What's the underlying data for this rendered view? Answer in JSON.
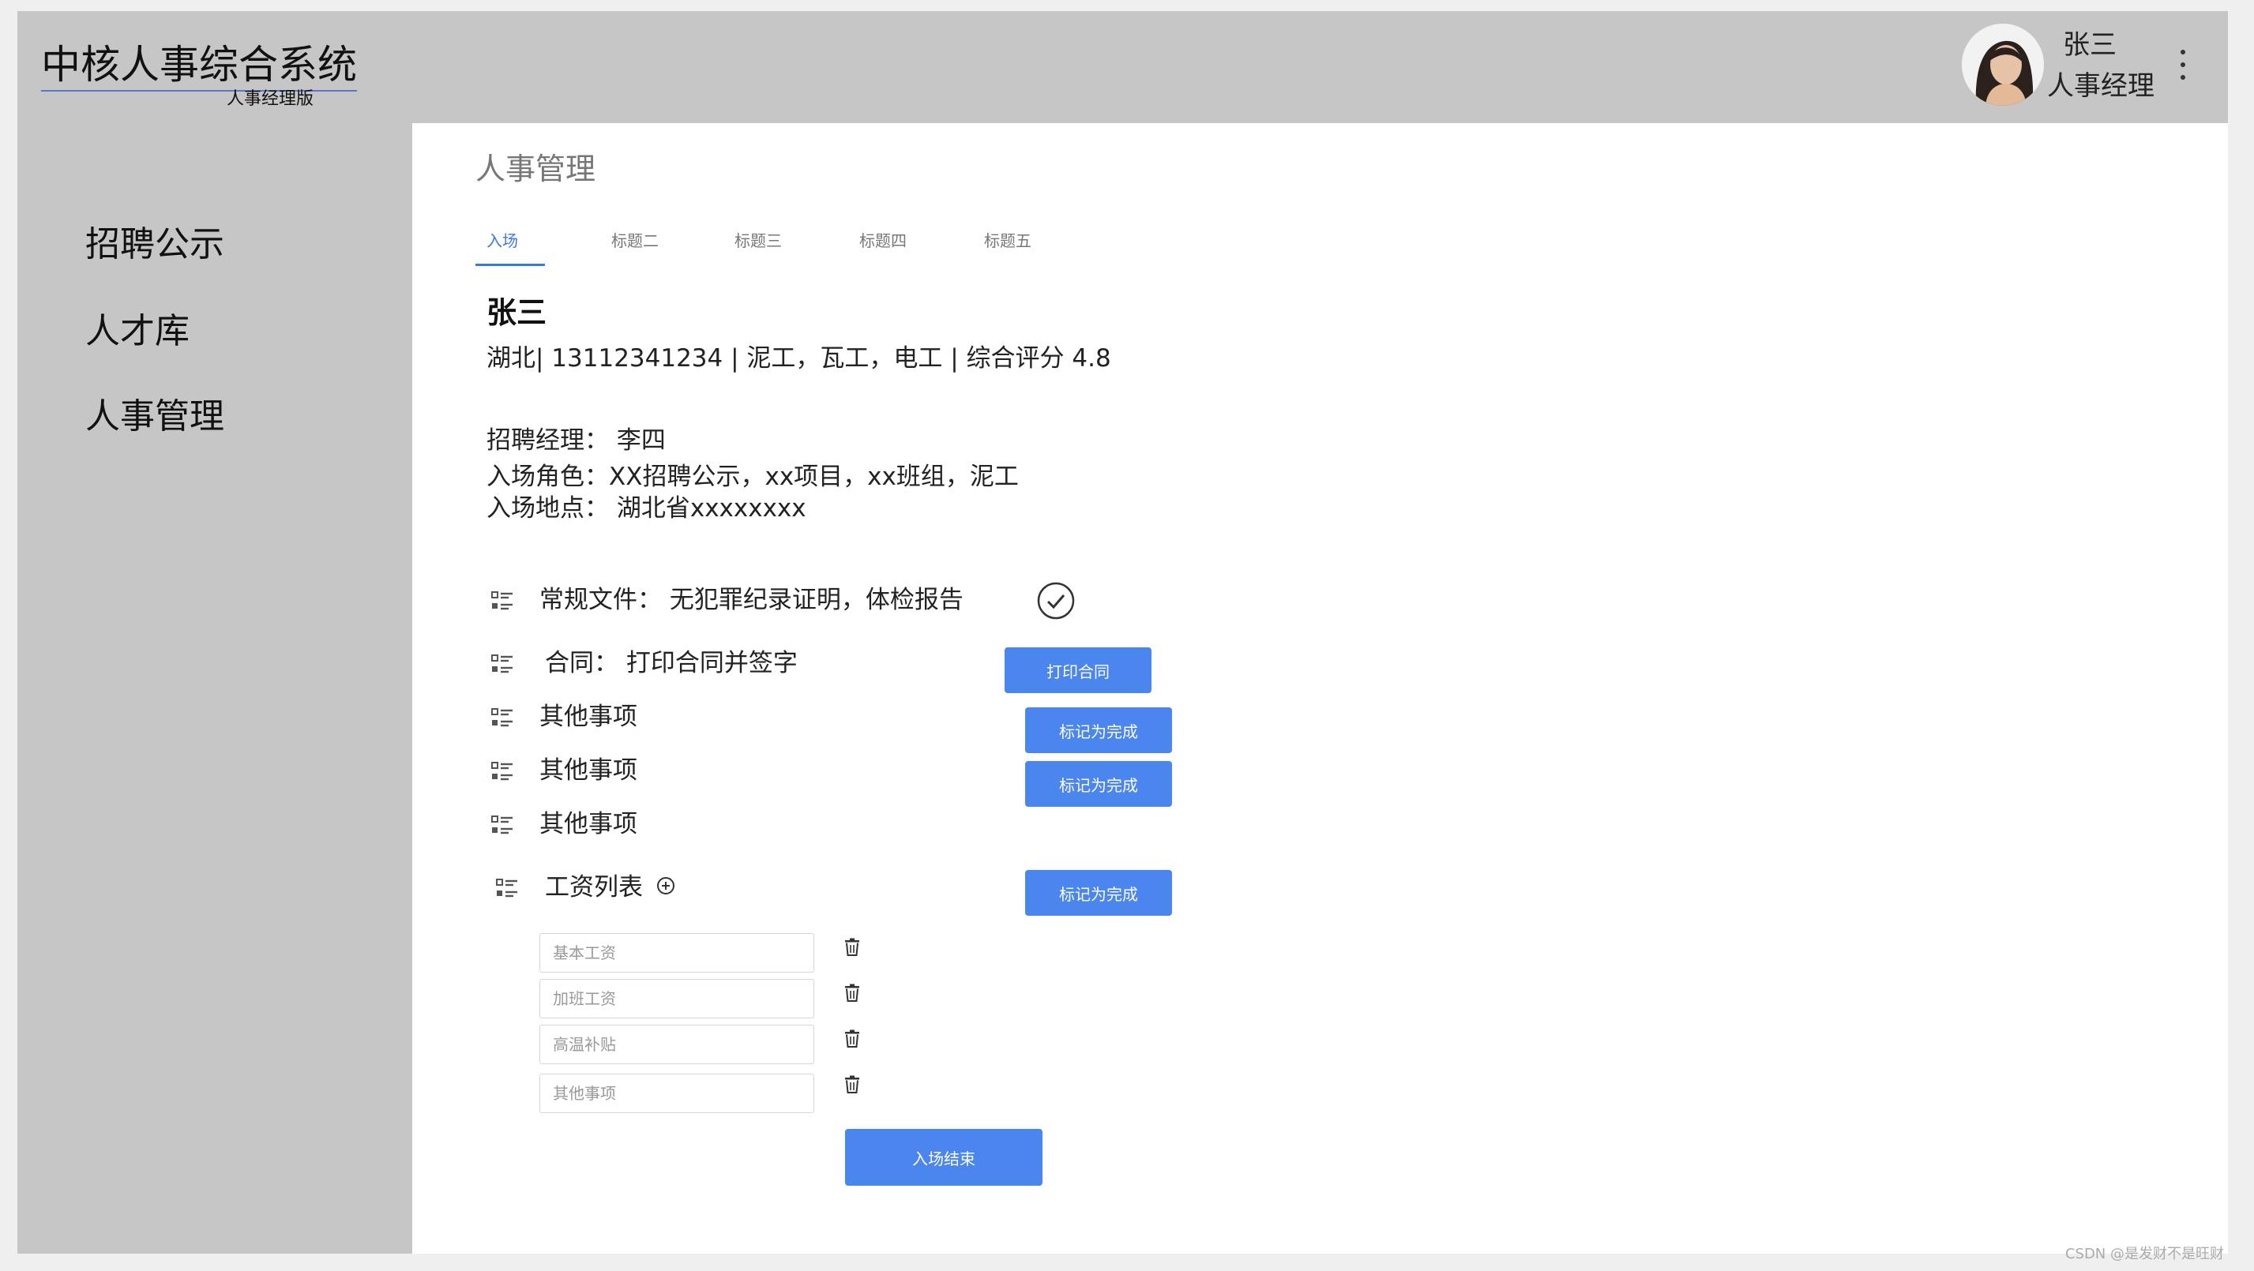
{
  "header": {
    "app_title": "中核人事综合系统",
    "app_subtitle": "人事经理版",
    "user_name": "张三",
    "user_role": "人事经理"
  },
  "sidebar": {
    "items": [
      {
        "label": "招聘公示"
      },
      {
        "label": "人才库"
      },
      {
        "label": "人事管理"
      }
    ]
  },
  "main": {
    "page_title": "人事管理",
    "tabs": [
      {
        "label": "入场",
        "active": true
      },
      {
        "label": "标题二"
      },
      {
        "label": "标题三"
      },
      {
        "label": "标题四"
      },
      {
        "label": "标题五"
      }
    ],
    "person": {
      "name": "张三",
      "summary": "湖北| 13112341234 | 泥工，瓦工，电工 | 综合评分 4.8",
      "manager": "招聘经理： 李四",
      "role": "入场角色：XX招聘公示，xx项目，xx班组，泥工",
      "location": "入场地点： 湖北省xxxxxxxx"
    },
    "tasks": [
      {
        "label": "常规文件： 无犯罪纪录证明，体检报告",
        "status_icon": "check-circle-icon"
      },
      {
        "label": "合同： 打印合同并签字",
        "button": "打印合同"
      },
      {
        "label": "其他事项",
        "button": "标记为完成"
      },
      {
        "label": "其他事项",
        "button": "标记为完成"
      },
      {
        "label": "其他事项"
      }
    ],
    "salary": {
      "title": "工资列表",
      "button": "标记为完成",
      "fields": [
        {
          "placeholder": "基本工资"
        },
        {
          "placeholder": "加班工资"
        },
        {
          "placeholder": "高温补贴"
        },
        {
          "placeholder": "其他事项"
        }
      ]
    },
    "finish_button": "入场结束"
  },
  "watermark": "CSDN @是发财不是旺财",
  "colors": {
    "primary": "#4a86ee",
    "header_bg": "#c6c6c6",
    "tab_active": "#3b78e7"
  }
}
